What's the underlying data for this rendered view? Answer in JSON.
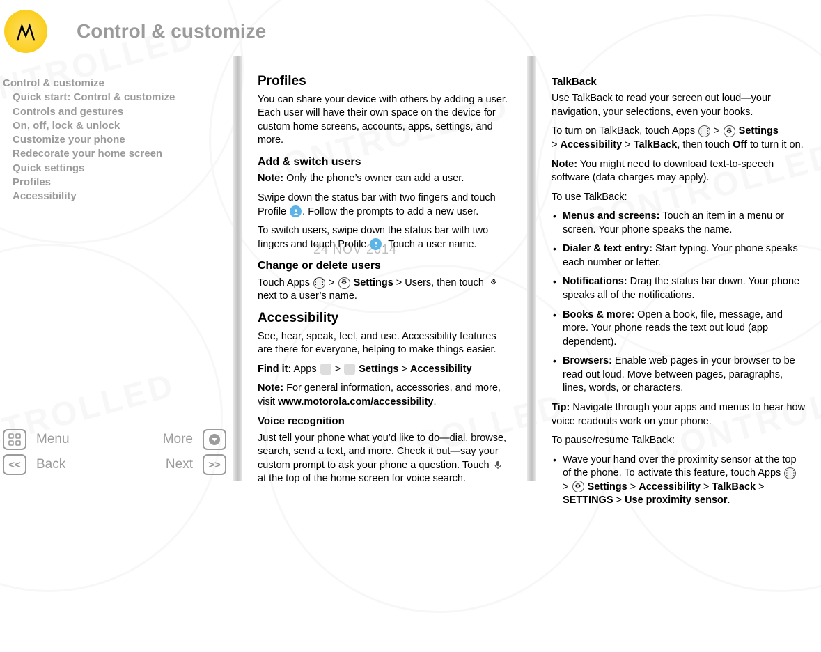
{
  "header": {
    "title": "Control & customize"
  },
  "watermark_date": "24 NOV 2014",
  "toc": {
    "root": "Control & customize",
    "items": [
      "Quick start: Control & customize",
      "Controls and gestures",
      "On, off, lock & unlock",
      "Customize your phone",
      "Redecorate your home screen",
      "Quick settings",
      "Profiles",
      "Accessibility"
    ]
  },
  "nav": {
    "menu": "Menu",
    "more": "More",
    "back": "Back",
    "next": "Next"
  },
  "col1": {
    "h_profiles": "Profiles",
    "p_profiles": "You can share your device with others by adding a user. Each user will have their own space on the device for custom home screens, accounts, apps, settings, and more.",
    "h_addswitch": "Add & switch users",
    "note_label": "Note:",
    "note_owner": " Only the phone’s owner can add a user.",
    "p_swipe1a": "Swipe down the status bar with two fingers and touch Profile ",
    "p_swipe1b": ". Follow the prompts to add a new user.",
    "p_switch_a": "To switch users, swipe down the status bar with two fingers and touch Profile ",
    "p_switch_b": ". Touch a user name.",
    "h_change": "Change or delete users",
    "p_change_a": "Touch Apps ",
    "arrow": " > ",
    "settings_bold": "Settings",
    "p_change_b": " > Users, then touch ",
    "p_change_c": " next to a user’s name.",
    "h_access": "Accessibility",
    "p_access": "See, hear, speak, feel, and use. Accessibility features are there for everyone, helping to make things easier.",
    "findit_label": "Find it:",
    "findit_a": " Apps ",
    "findit_b": "Settings",
    "findit_c": "Accessibility",
    "note_general": " For general information, accessories, and more, visit ",
    "url": "www.motorola.com/accessibility",
    "period": ".",
    "h_voice": "Voice recognition",
    "p_voice_a": "Just tell your phone what you’d like to do—dial, browse, search, send a text, and more. Check it out—say your custom prompt to ask your phone a question. Touch ",
    "p_voice_b": " at the top of the home screen for voice search."
  },
  "col2": {
    "h_talkback": "TalkBack",
    "p_tb1": "Use TalkBack to read your screen out loud—your navigation, your selections, even your books.",
    "p_tb2_a": "To turn on TalkBack, touch Apps ",
    "settings": "Settings",
    "accessibility": "Accessibility",
    "talkback": "TalkBack",
    "p_tb2_b": ", then touch ",
    "off": "Off",
    "p_tb2_c": " to turn it on.",
    "note_dl": " You might need to download text-to-speech software (data charges may apply).",
    "p_use": "To use TalkBack:",
    "li_menus_t": "Menus and screens:",
    "li_menus": " Touch an item in a menu or screen. Your phone speaks the name.",
    "li_dialer_t": "Dialer & text entry:",
    "li_dialer": " Start typing. Your phone speaks each number or letter.",
    "li_notif_t": "Notifications:",
    "li_notif": " Drag the status bar down. Your phone speaks all of the notifications.",
    "li_books_t": "Books & more:",
    "li_books": " Open a book, file, message, and more. Your phone reads the text out loud (app dependent).",
    "li_brows_t": "Browsers:",
    "li_brows": " Enable web pages in your browser to be read out loud. Move between pages, paragraphs, lines, words, or characters.",
    "tip_label": "Tip:",
    "tip": " Navigate through your apps and menus to hear how voice readouts work on your phone.",
    "p_pause": "To pause/resume TalkBack:",
    "li_wave_a": "Wave your hand over the proximity sensor at the top of the phone. To activate this feature, touch Apps ",
    "settings_path": "SETTINGS",
    "use_prox": "Use proximity sensor"
  }
}
